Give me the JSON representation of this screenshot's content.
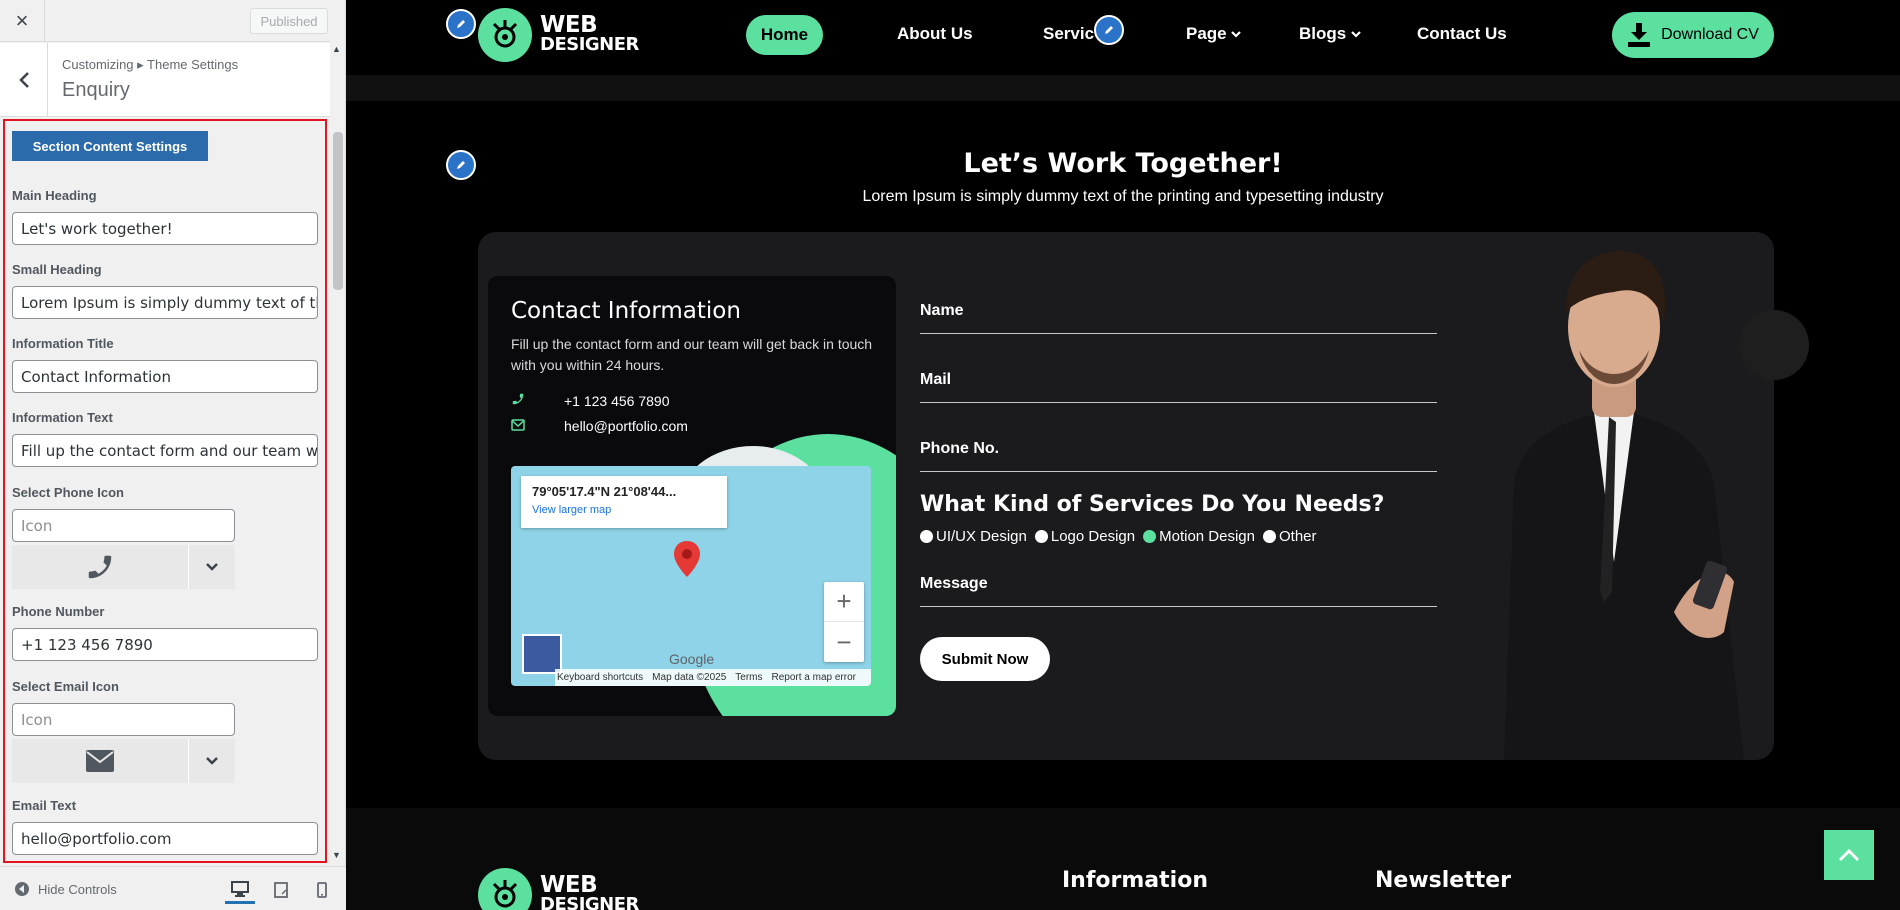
{
  "customizer": {
    "close_glyph": "×",
    "publish_label": "Published",
    "back_glyph": "‹",
    "breadcrumb": "Customizing ▸ Theme Settings",
    "section_title": "Enquiry",
    "section_button": "Section Content Settings",
    "fields": {
      "main_heading": {
        "label": "Main Heading",
        "value": "Let's work together!"
      },
      "small_heading": {
        "label": "Small Heading",
        "value": "Lorem Ipsum is simply dummy text of the"
      },
      "info_title": {
        "label": "Information Title",
        "value": "Contact Information"
      },
      "info_text": {
        "label": "Information Text",
        "value": "Fill up the contact form and our team wi"
      },
      "phone_icon": {
        "label": "Select Phone Icon",
        "placeholder": "Icon"
      },
      "phone_number": {
        "label": "Phone Number",
        "value": "+1 123 456 7890"
      },
      "email_icon": {
        "label": "Select Email Icon",
        "placeholder": "Icon"
      },
      "email_text": {
        "label": "Email Text",
        "value": "hello@portfolio.com"
      }
    },
    "hide_controls": "Hide Controls"
  },
  "site": {
    "logo": {
      "line1": "WEB",
      "line2": "DESIGNER"
    },
    "nav": {
      "home": "Home",
      "about": "About Us",
      "services": "Servic",
      "page": "Page",
      "blogs": "Blogs",
      "contact": "Contact Us",
      "download": "Download CV"
    },
    "section": {
      "heading": "Let’s Work Together!",
      "subheading": "Lorem Ipsum is simply dummy text of the printing and typesetting industry"
    },
    "contact": {
      "title": "Contact Information",
      "text": "Fill up the contact form and our team will get back in touch with you within 24 hours.",
      "phone": "+1 123 456 7890",
      "email": "hello@portfolio.com"
    },
    "map": {
      "coords": "79°05'17.4\"N 21°08'44...",
      "larger_link": "View larger map",
      "zoom_in": "+",
      "zoom_out": "−",
      "google": "Google",
      "footer": [
        "Keyboard shortcuts",
        "Map data ©2025",
        "Terms",
        "Report a map error"
      ]
    },
    "form": {
      "name": "Name",
      "mail": "Mail",
      "phone": "Phone No.",
      "services_heading": "What Kind of Services Do You Needs?",
      "options": [
        {
          "label": "UI/UX Design",
          "checked": false
        },
        {
          "label": "Logo Design",
          "checked": false
        },
        {
          "label": "Motion Design",
          "checked": true
        },
        {
          "label": "Other",
          "checked": false
        }
      ],
      "message": "Message",
      "submit": "Submit Now"
    },
    "footer": {
      "information": "Information",
      "newsletter": "Newsletter"
    }
  },
  "colors": {
    "accent": "#5ce0a0",
    "customizer_blue": "#2c6bab",
    "highlight_red": "#e1151f",
    "edit_blue": "#2a73c9"
  },
  "icons": [
    "close-icon",
    "back-icon",
    "phone-icon",
    "chevron-down-icon",
    "envelope-icon",
    "eye-icon",
    "desktop-icon",
    "tablet-icon",
    "mobile-icon",
    "pencil-icon",
    "download-icon",
    "map-pin-icon",
    "arrow-up-icon"
  ]
}
